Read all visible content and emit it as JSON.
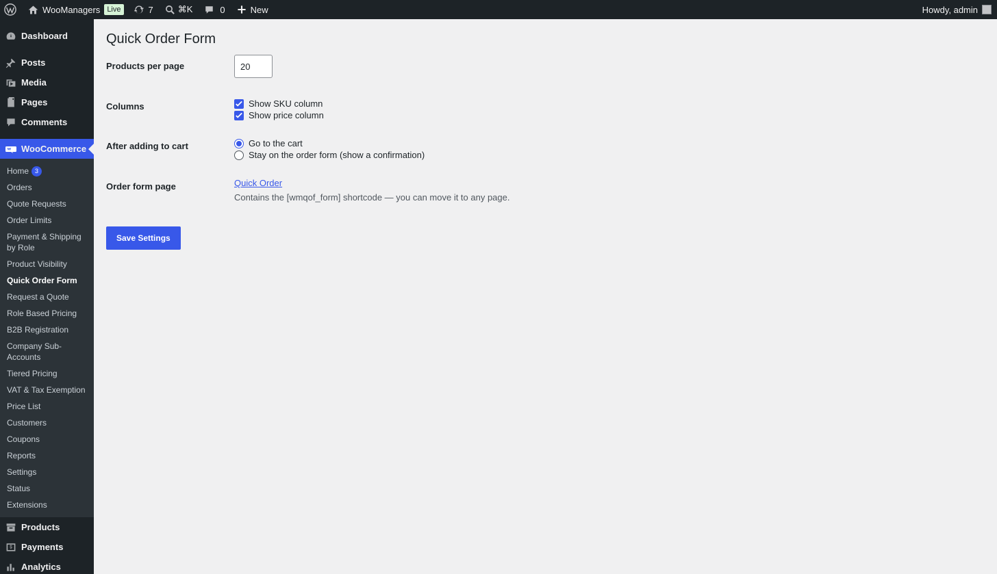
{
  "adminbar": {
    "site_name": "WooManagers",
    "live_badge": "Live",
    "updates_count": "7",
    "search_shortcut": "⌘K",
    "comments_count": "0",
    "new_label": "New",
    "howdy": "Howdy, admin"
  },
  "sidebar": {
    "top_items": [
      {
        "label": "Dashboard",
        "icon": "dashboard-icon"
      },
      {
        "label": "Posts",
        "icon": "pin-icon"
      },
      {
        "label": "Media",
        "icon": "media-icon"
      },
      {
        "label": "Pages",
        "icon": "pages-icon"
      },
      {
        "label": "Comments",
        "icon": "comment-icon"
      },
      {
        "label": "WooCommerce",
        "icon": "woo-icon"
      }
    ],
    "woo_submenu": [
      {
        "label": "Home",
        "badge": "3"
      },
      {
        "label": "Orders"
      },
      {
        "label": "Quote Requests"
      },
      {
        "label": "Order Limits"
      },
      {
        "label": "Payment & Shipping by Role"
      },
      {
        "label": "Product Visibility"
      },
      {
        "label": "Quick Order Form"
      },
      {
        "label": "Request a Quote"
      },
      {
        "label": "Role Based Pricing"
      },
      {
        "label": "B2B Registration"
      },
      {
        "label": "Company Sub-Accounts"
      },
      {
        "label": "Tiered Pricing"
      },
      {
        "label": "VAT & Tax Exemption"
      },
      {
        "label": "Price List"
      },
      {
        "label": "Customers"
      },
      {
        "label": "Coupons"
      },
      {
        "label": "Reports"
      },
      {
        "label": "Settings"
      },
      {
        "label": "Status"
      },
      {
        "label": "Extensions"
      }
    ],
    "bottom_items": [
      {
        "label": "Products",
        "icon": "products-icon"
      },
      {
        "label": "Payments",
        "icon": "payments-icon"
      },
      {
        "label": "Analytics",
        "icon": "analytics-icon"
      }
    ]
  },
  "main": {
    "title": "Quick Order Form",
    "products_per_page_label": "Products per page",
    "products_per_page_value": "20",
    "columns_label": "Columns",
    "show_sku_label": "Show SKU column",
    "show_price_label": "Show price column",
    "after_cart_label": "After adding to cart",
    "radio_go_cart": "Go to the cart",
    "radio_stay": "Stay on the order form (show a confirmation)",
    "order_form_page_label": "Order form page",
    "order_form_page_link": "Quick Order",
    "order_form_page_desc": "Contains the [wmqof_form] shortcode — you can move it to any page.",
    "save_button": "Save Settings"
  },
  "colors": {
    "accent": "#3858e9",
    "adminbar_bg": "#1d2327",
    "content_bg": "#f0f0f1"
  }
}
